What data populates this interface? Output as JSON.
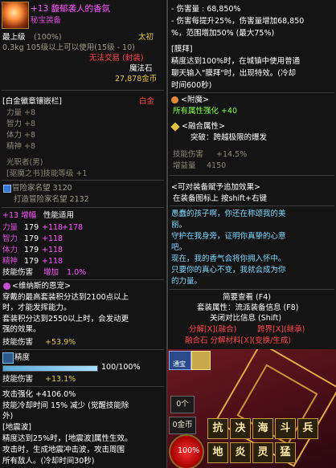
{
  "item": {
    "name": "+13 馥郁袭人的香氛",
    "type": "秘宝装备",
    "grade": "最上级",
    "grade_pct": "(100%)",
    "weight_level": "0.3kg  105级以上可以使用(15级 - 10)",
    "rarity": "太初",
    "trade": "无法交易 (封装)",
    "material": "魔法石",
    "price": "27,878金币"
  },
  "socket": {
    "label": "[白金徽章镶嵌栏]",
    "tag": "白金",
    "stats": [
      "力量 +8",
      "智力 +8",
      "体力 +8",
      "精神 +8"
    ],
    "skill_lines": [
      "光职者(男)",
      "[驱魔之书]技能等级 +1"
    ]
  },
  "adventurer": {
    "fame": "冒险家名望 3120",
    "forge": "打造冒险家名望 2132"
  },
  "amplify": {
    "header": "+13 增幅",
    "header_suffix": "性能适用",
    "rows": [
      {
        "stat": "力量",
        "base": "179",
        "add1": "+118",
        "add2": "+178"
      },
      {
        "stat": "智力",
        "base": "179",
        "add1": "+118",
        "add2": ""
      },
      {
        "stat": "体力",
        "base": "179",
        "add1": "+118",
        "add2": ""
      },
      {
        "stat": "精神",
        "base": "179",
        "add1": "+118",
        "add2": ""
      }
    ],
    "skill_attack_label": "技能伤害",
    "skill_attack_mid": "增加",
    "skill_attack_value": "1.0%"
  },
  "grace": {
    "title": "<维纳斯的恩宠>",
    "lines": [
      "穿戴的最高套装积分达到2100点以上",
      "时，才能发挥能力。",
      "套装积分达到2550以上时，会发动更",
      "强的效果。"
    ],
    "skill_label": "技能伤害",
    "skill_value": "+53.9%"
  },
  "precision": {
    "label": "精度",
    "value_text": "100/100%",
    "fraction": 1.0,
    "skill_label": "技能伤害",
    "skill_value": "+13.1%"
  },
  "attack": {
    "line1": "攻击强化 +4106.0%",
    "line2": "技能冷却时间 15% 减少 (觉醒技能除",
    "line3": "外)"
  },
  "quake": {
    "title": "[地震波]",
    "lines": [
      "精度达到25%时，[地震波]属性生效。",
      "攻击时，生成地震冲击波，攻击周围",
      "所有敌人。(冷却时间30秒)"
    ]
  },
  "right": {
    "damage_lines": [
      "- 伤害量 : 68,850%",
      "- 伤害每提升25%，伤害量增加68,850",
      "%，范围增加50% (最大75%)"
    ],
    "worship_title": "[膜拜]",
    "worship_lines": [
      "精度达到100%时，在城镇中使用普通",
      "聊天输入\"膜拜\"时，出现特效。(冷却",
      "时间600秒)"
    ],
    "enchant_title": "<附魔>",
    "enchant_line": "所有属性强化 +40",
    "fusion_title": "<融合属性>",
    "fusion_line": "突破：跨越极限的爆发",
    "skill_label": "技能伤害",
    "skill_value": "+14.5%",
    "increase_label": "增益量",
    "increase_value": "4150",
    "set_hint_title": "<可对装备赋予追加效果>",
    "set_hint_line": "在装备图标上 按shift+右键",
    "flavor": [
      "愚蠢的孩子啊，你还在称颂我的美",
      "丽。",
      "守护在我身旁，证明你真挚的心意",
      "吧。",
      "现在，我的香气会将你拥入怀中。",
      "只要你的真心不变，我就会成为你",
      "的力量。"
    ],
    "menu": {
      "brief": "简要查看 (F4)",
      "set_info": "套装属性：流派装备信息 (F8)",
      "close_compare": "关闭对比信息 (Shift)",
      "decompose": "分解[X](融合)",
      "cross": "跨界[X](继承)",
      "fusion_stone": "融合石 分解材料[X](变换/生成)"
    }
  },
  "hud": {
    "count": "0个",
    "gold": "0金币",
    "hp_pct": "100%",
    "shop_label": "通宝",
    "slots": [
      "抗",
      "决",
      "海",
      "斗",
      "兵",
      "地",
      "炎",
      "灵",
      "猛"
    ]
  },
  "colors": {
    "title": "#ff5bff",
    "gold": "#e7c34a",
    "enchant_green": "#7dff4a",
    "flavor": "#7fd8ff",
    "menu_red": "#ff4a4a"
  }
}
